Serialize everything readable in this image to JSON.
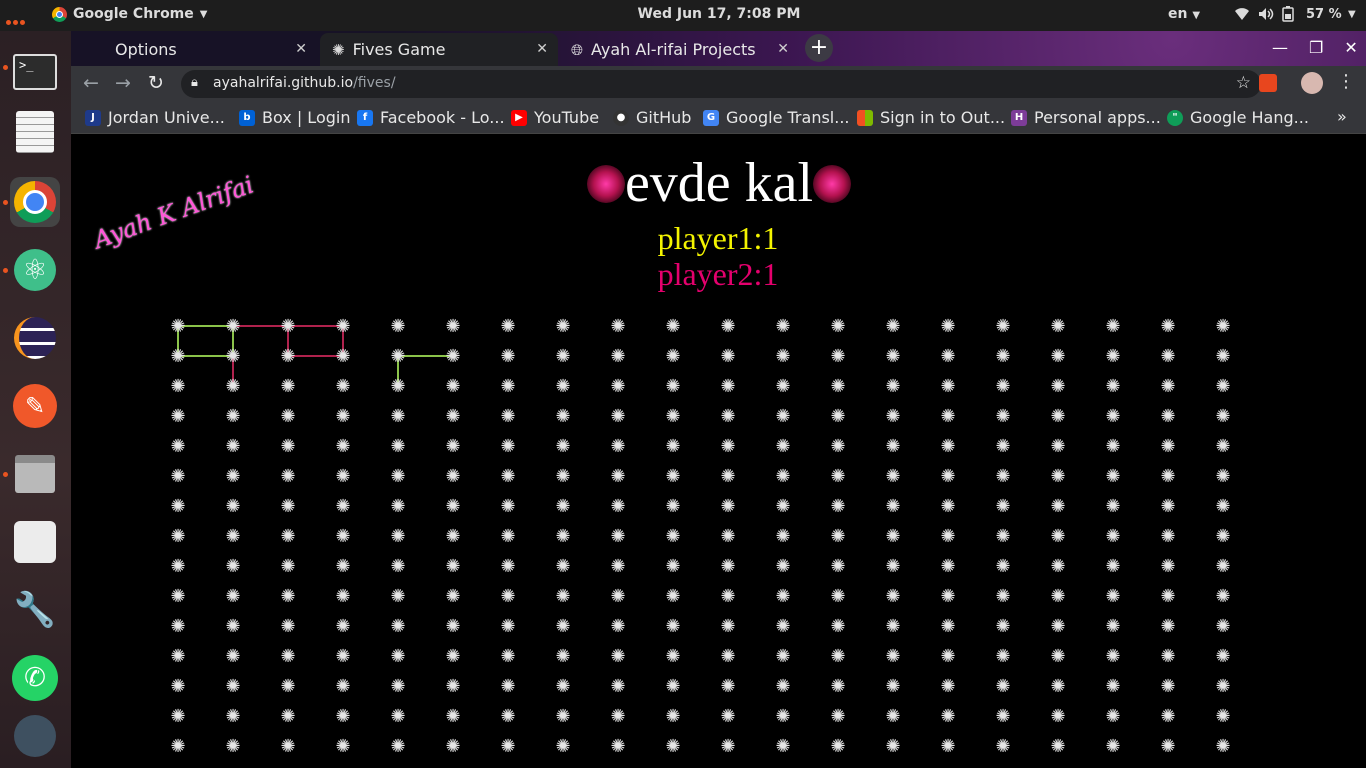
{
  "topbar": {
    "app_menu": "Google Chrome",
    "clock": "Wed Jun 17,  7:08 PM",
    "lang": "en",
    "battery": "57 %"
  },
  "tabs": [
    {
      "label": "Options",
      "active": false
    },
    {
      "label": "Fives Game",
      "active": true
    },
    {
      "label": "Ayah Al-rifai Projects",
      "active": false
    }
  ],
  "address": {
    "host": "ayahalrifai.github.io",
    "path": "/fives/"
  },
  "bookmarks": [
    {
      "label": "Jordan Unive...",
      "color": "#1e3a8a",
      "glyph": "J"
    },
    {
      "label": "Box | Login",
      "color": "#0061d5",
      "glyph": "b"
    },
    {
      "label": "Facebook - Lo...",
      "color": "#1877f2",
      "glyph": "f"
    },
    {
      "label": "YouTube",
      "color": "#ff0000",
      "glyph": "▶"
    },
    {
      "label": "GitHub",
      "color": "#333333",
      "glyph": "●"
    },
    {
      "label": "Google Transl...",
      "color": "#4285f4",
      "glyph": "G"
    },
    {
      "label": "Sign in to Out...",
      "color": "#f25022",
      "glyph": "■"
    },
    {
      "label": "Personal apps...",
      "color": "#7d3c98",
      "glyph": "H"
    },
    {
      "label": "Google Hang...",
      "color": "#0f9d58",
      "glyph": "\""
    }
  ],
  "game": {
    "title": "evde kal",
    "player1": "player1:1",
    "player2": "player2:1",
    "signature": "Ayah K Alrifai",
    "board": {
      "cols": 20,
      "rows": 15
    },
    "colors": {
      "player1": "#8bc34a",
      "player2": "#b0224d",
      "dot": "#e6e6e6"
    },
    "lines": [
      {
        "from": [
          0,
          0
        ],
        "to": [
          1,
          0
        ],
        "player": 1
      },
      {
        "from": [
          0,
          0
        ],
        "to": [
          0,
          1
        ],
        "player": 1
      },
      {
        "from": [
          0,
          1
        ],
        "to": [
          1,
          1
        ],
        "player": 1
      },
      {
        "from": [
          1,
          0
        ],
        "to": [
          1,
          1
        ],
        "player": 1
      },
      {
        "from": [
          1,
          0
        ],
        "to": [
          2,
          0
        ],
        "player": 2
      },
      {
        "from": [
          2,
          0
        ],
        "to": [
          3,
          0
        ],
        "player": 2
      },
      {
        "from": [
          2,
          0
        ],
        "to": [
          2,
          1
        ],
        "player": 2
      },
      {
        "from": [
          2,
          1
        ],
        "to": [
          3,
          1
        ],
        "player": 2
      },
      {
        "from": [
          3,
          0
        ],
        "to": [
          3,
          1
        ],
        "player": 2
      },
      {
        "from": [
          1,
          1
        ],
        "to": [
          1,
          2
        ],
        "player": 2
      },
      {
        "from": [
          4,
          1
        ],
        "to": [
          5,
          1
        ],
        "player": 1
      },
      {
        "from": [
          4,
          1
        ],
        "to": [
          4,
          2
        ],
        "player": 1
      }
    ]
  }
}
